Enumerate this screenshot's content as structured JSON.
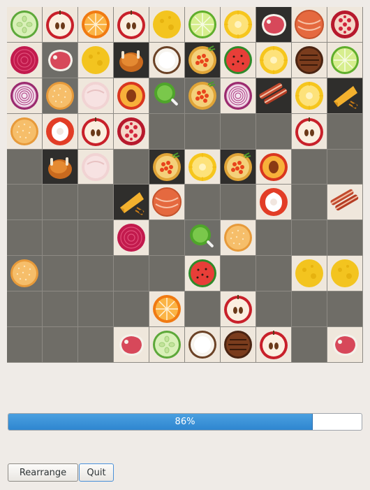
{
  "board": {
    "rows": [
      [
        "cucumber",
        "apple",
        "orange",
        "apple",
        "cheese",
        "lime",
        "pineapple",
        "steak",
        "salmon",
        "pomegranate"
      ],
      [
        "beet",
        "steak",
        "cheese",
        "roast-chicken",
        "coconut",
        "salmon-roe",
        "watermelon",
        "pineapple",
        "burger",
        "lime"
      ],
      [
        "red-onion",
        "cookie",
        "ice-cream",
        "peach",
        "lollipop",
        "salmon-roe",
        "red-onion",
        "bacon",
        "pineapple",
        "cheese-wedge"
      ],
      [
        "cookie",
        "bell-pepper",
        "apple",
        "pomegranate",
        null,
        null,
        null,
        null,
        "apple",
        null
      ],
      [
        null,
        "roast-chicken",
        "ice-cream",
        null,
        "salmon-roe",
        "pineapple",
        "salmon-roe",
        "peach",
        null,
        null
      ],
      [
        null,
        null,
        null,
        "cheese-wedge",
        "salmon",
        null,
        null,
        "bell-pepper",
        null,
        "bacon"
      ],
      [
        null,
        null,
        null,
        "beet",
        null,
        "lollipop",
        "cookie",
        null,
        null,
        null
      ],
      [
        "cookie",
        null,
        null,
        null,
        null,
        "watermelon",
        null,
        null,
        "cheese",
        "cheese"
      ],
      [
        null,
        null,
        null,
        null,
        "orange",
        null,
        "apple",
        null,
        null,
        null
      ],
      [
        null,
        null,
        null,
        "steak",
        "cucumber",
        "coconut",
        "burger",
        "apple",
        null,
        "steak"
      ]
    ],
    "tile_backgrounds": [
      [
        "light",
        "light",
        "light",
        "light",
        "light",
        "light",
        "light",
        "dark",
        "light",
        "light"
      ],
      [
        "light",
        "mid",
        "light",
        "dark",
        "light",
        "dark",
        "light",
        "light",
        "light",
        "light"
      ],
      [
        "light",
        "mid",
        "light",
        "light",
        "mid",
        "mid",
        "light",
        "dark",
        "light",
        "dark"
      ],
      [
        "light",
        "light",
        "light",
        "light",
        null,
        null,
        null,
        null,
        "light",
        null
      ],
      [
        null,
        "dark",
        "light",
        null,
        "dark",
        "light",
        "dark",
        "light",
        null,
        null
      ],
      [
        null,
        null,
        null,
        "dark",
        "light",
        null,
        null,
        "light",
        null,
        "light"
      ],
      [
        null,
        null,
        null,
        "light",
        null,
        "mid",
        "light",
        null,
        null,
        null
      ],
      [
        "mid",
        null,
        null,
        null,
        null,
        "light",
        null,
        null,
        "light",
        "light"
      ],
      [
        null,
        null,
        null,
        null,
        "light",
        null,
        "light",
        null,
        null,
        null
      ],
      [
        null,
        null,
        null,
        "light",
        "light",
        "light",
        "light",
        "light",
        null,
        "light"
      ]
    ]
  },
  "progress": {
    "value": 86,
    "label": "86%"
  },
  "buttons": {
    "rearrange": "Rearrange",
    "quit": "Quit"
  },
  "colors": {
    "progress_fill": "#2f86d0",
    "empty_cell": "#6f6d67",
    "tile_bg": "#efe7dc"
  }
}
